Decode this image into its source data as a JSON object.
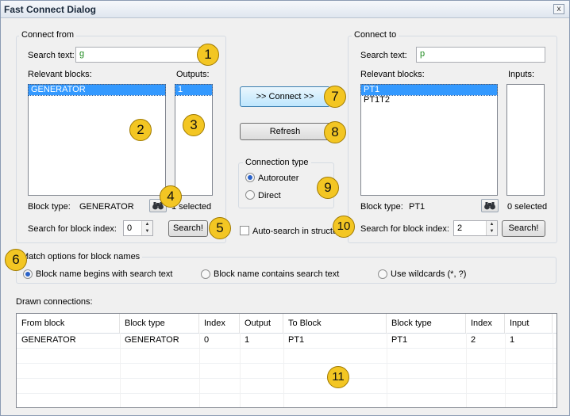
{
  "window": {
    "title": "Fast Connect Dialog",
    "close_glyph": "x"
  },
  "connect_from": {
    "group_title": "Connect from",
    "search_label": "Search text:",
    "search_value": "g",
    "relevant_label": "Relevant blocks:",
    "blocks": [
      "GENERATOR"
    ],
    "outputs_label": "Outputs:",
    "outputs": [
      "1"
    ],
    "block_type_label": "Block type:",
    "block_type_value": "GENERATOR",
    "selected_text": "1 selected",
    "index_label": "Search for block index:",
    "index_value": "0",
    "search_button": "Search!"
  },
  "connect_to": {
    "group_title": "Connect to",
    "search_label": "Search text:",
    "search_value": "p",
    "relevant_label": "Relevant blocks:",
    "blocks": [
      "PT1",
      "PT1T2"
    ],
    "inputs_label": "Inputs:",
    "block_type_label": "Block type:",
    "block_type_value": "PT1",
    "selected_text": "0 selected",
    "index_label": "Search for block index:",
    "index_value": "2",
    "search_button": "Search!"
  },
  "middle": {
    "connect_button": ">> Connect >>",
    "refresh_button": "Refresh",
    "connection_type_title": "Connection type",
    "autorouter_label": "Autorouter",
    "direct_label": "Direct",
    "auto_search_label": "Auto-search in structure"
  },
  "match_options": {
    "title": "Match options for block names",
    "option_begins": "Block name begins with search text",
    "option_contains": "Block name contains search text",
    "option_wildcards": "Use wildcards (*, ?)",
    "selected": "begins"
  },
  "drawn": {
    "label": "Drawn connections:",
    "columns": [
      "From block",
      "Block type",
      "Index",
      "Output",
      "To Block",
      "Block type",
      "Index",
      "Input"
    ],
    "rows": [
      [
        "GENERATOR",
        "GENERATOR",
        "0",
        "1",
        "PT1",
        "PT1",
        "2",
        "1"
      ]
    ]
  },
  "callouts": [
    "1",
    "2",
    "3",
    "4",
    "5",
    "6",
    "7",
    "8",
    "9",
    "10",
    "11"
  ],
  "colors": {
    "selection": "#3399ff",
    "callout": "#f3c623",
    "text_green": "#1f8a1f"
  },
  "icons": {
    "find_block": "binoculars-icon"
  }
}
